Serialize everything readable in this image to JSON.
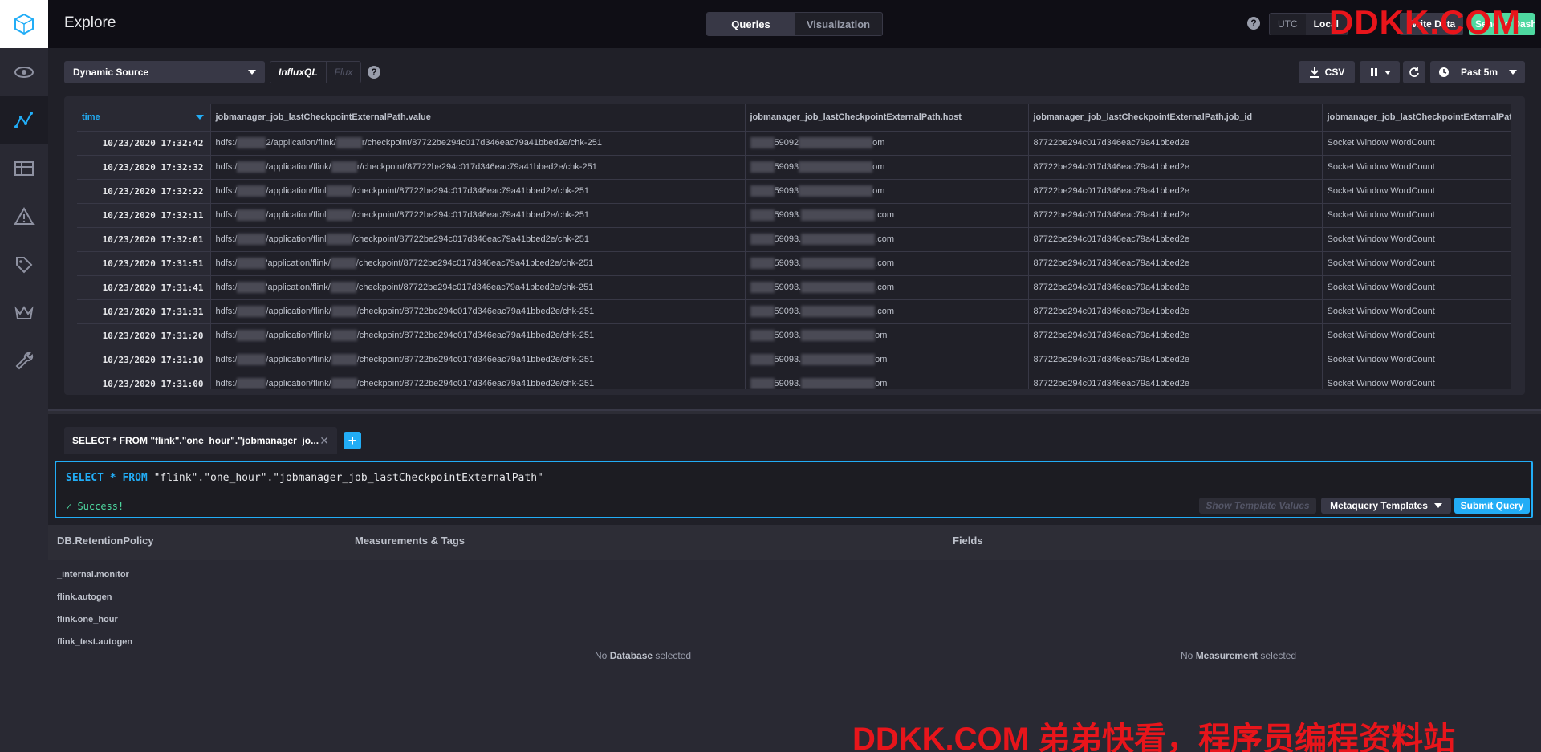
{
  "header": {
    "title": "Explore",
    "view_tabs": [
      {
        "label": "Queries",
        "active": true
      },
      {
        "label": "Visualization",
        "active": false
      }
    ],
    "timezone": {
      "utc": "UTC",
      "local": "Local"
    },
    "write_label": "Write Data",
    "send_label": "Send to Dashboard"
  },
  "toolbar": {
    "source": "Dynamic Source",
    "lang": {
      "influxql": "InfluxQL",
      "flux": "Flux"
    },
    "csv_label": "CSV",
    "time_range": "Past 5m"
  },
  "table": {
    "columns": [
      "time",
      "jobmanager_job_lastCheckpointExternalPath.value",
      "jobmanager_job_lastCheckpointExternalPath.host",
      "jobmanager_job_lastCheckpointExternalPath.job_id",
      "jobmanager_job_lastCheckpointExternalPath.job_name"
    ],
    "rows": [
      {
        "time": "10/23/2020 17:32:42",
        "value_a": "hdfs:/",
        "value_b": "2/application/flink/",
        "value_c": "r/checkpoint/87722be294c017d346eac79a41bbed2e/chk-251",
        "host_a": "59092",
        "host_b": "om",
        "job_id": "87722be294c017d346eac79a41bbed2e",
        "job_name": "Socket Window WordCount"
      },
      {
        "time": "10/23/2020 17:32:32",
        "value_a": "hdfs:/",
        "value_b": "/application/flink/",
        "value_c": "r/checkpoint/87722be294c017d346eac79a41bbed2e/chk-251",
        "host_a": "59093",
        "host_b": "om",
        "job_id": "87722be294c017d346eac79a41bbed2e",
        "job_name": "Socket Window WordCount"
      },
      {
        "time": "10/23/2020 17:32:22",
        "value_a": "hdfs:/",
        "value_b": "/application/flinl",
        "value_c": "/checkpoint/87722be294c017d346eac79a41bbed2e/chk-251",
        "host_a": "59093",
        "host_b": "om",
        "job_id": "87722be294c017d346eac79a41bbed2e",
        "job_name": "Socket Window WordCount"
      },
      {
        "time": "10/23/2020 17:32:11",
        "value_a": "hdfs:/",
        "value_b": "/application/flinl",
        "value_c": "/checkpoint/87722be294c017d346eac79a41bbed2e/chk-251",
        "host_a": "59093.",
        "host_b": ".com",
        "job_id": "87722be294c017d346eac79a41bbed2e",
        "job_name": "Socket Window WordCount"
      },
      {
        "time": "10/23/2020 17:32:01",
        "value_a": "hdfs:/",
        "value_b": "/application/flinl",
        "value_c": "/checkpoint/87722be294c017d346eac79a41bbed2e/chk-251",
        "host_a": "59093.",
        "host_b": ".com",
        "job_id": "87722be294c017d346eac79a41bbed2e",
        "job_name": "Socket Window WordCount"
      },
      {
        "time": "10/23/2020 17:31:51",
        "value_a": "hdfs:/",
        "value_b": "'application/flink/",
        "value_c": "/checkpoint/87722be294c017d346eac79a41bbed2e/chk-251",
        "host_a": "59093.",
        "host_b": ".com",
        "job_id": "87722be294c017d346eac79a41bbed2e",
        "job_name": "Socket Window WordCount"
      },
      {
        "time": "10/23/2020 17:31:41",
        "value_a": "hdfs:/",
        "value_b": "'application/flink/",
        "value_c": "/checkpoint/87722be294c017d346eac79a41bbed2e/chk-251",
        "host_a": "59093.",
        "host_b": ".com",
        "job_id": "87722be294c017d346eac79a41bbed2e",
        "job_name": "Socket Window WordCount"
      },
      {
        "time": "10/23/2020 17:31:31",
        "value_a": "hdfs:/",
        "value_b": "/application/flink/",
        "value_c": "/checkpoint/87722be294c017d346eac79a41bbed2e/chk-251",
        "host_a": "59093.",
        "host_b": ".com",
        "job_id": "87722be294c017d346eac79a41bbed2e",
        "job_name": "Socket Window WordCount"
      },
      {
        "time": "10/23/2020 17:31:20",
        "value_a": "hdfs:/",
        "value_b": "/application/flink/",
        "value_c": "/checkpoint/87722be294c017d346eac79a41bbed2e/chk-251",
        "host_a": "59093.",
        "host_b": "om",
        "job_id": "87722be294c017d346eac79a41bbed2e",
        "job_name": "Socket Window WordCount"
      },
      {
        "time": "10/23/2020 17:31:10",
        "value_a": "hdfs:/",
        "value_b": "/application/flink/",
        "value_c": "/checkpoint/87722be294c017d346eac79a41bbed2e/chk-251",
        "host_a": "59093.",
        "host_b": "om",
        "job_id": "87722be294c017d346eac79a41bbed2e",
        "job_name": "Socket Window WordCount"
      },
      {
        "time": "10/23/2020 17:31:00",
        "value_a": "hdfs:/",
        "value_b": "/application/flink/",
        "value_c": "/checkpoint/87722be294c017d346eac79a41bbed2e/chk-251",
        "host_a": "59093.",
        "host_b": "om",
        "job_id": "87722be294c017d346eac79a41bbed2e",
        "job_name": "Socket Window WordCount"
      }
    ]
  },
  "query": {
    "tab_label": "SELECT * FROM \"flink\".\"one_hour\".\"jobmanager_jo...",
    "kw_select": "SELECT",
    "kw_star": "*",
    "kw_from": "FROM",
    "target": "\"flink\".\"one_hour\".\"jobmanager_job_lastCheckpointExternalPath\"",
    "status": "Success!",
    "show_template_values": "Show Template Values",
    "metaquery_templates": "Metaquery Templates",
    "submit": "Submit Query"
  },
  "schema": {
    "db_title": "DB.RetentionPolicy",
    "meas_title": "Measurements & Tags",
    "fields_title": "Fields",
    "databases": [
      "_internal.monitor",
      "flink.autogen",
      "flink.one_hour",
      "flink_test.autogen"
    ],
    "no_db": {
      "prefix": "No",
      "bold": "Database",
      "suffix": "selected"
    },
    "no_meas": {
      "prefix": "No",
      "bold": "Measurement",
      "suffix": "selected"
    }
  },
  "watermark": {
    "top": "DDKK.COM",
    "bottom": "DDKK.COM 弟弟快看，程序员编程资料站"
  },
  "colors": {
    "accent": "#22adf6",
    "success": "#4ed8a0",
    "watermark": "#e8151b"
  }
}
